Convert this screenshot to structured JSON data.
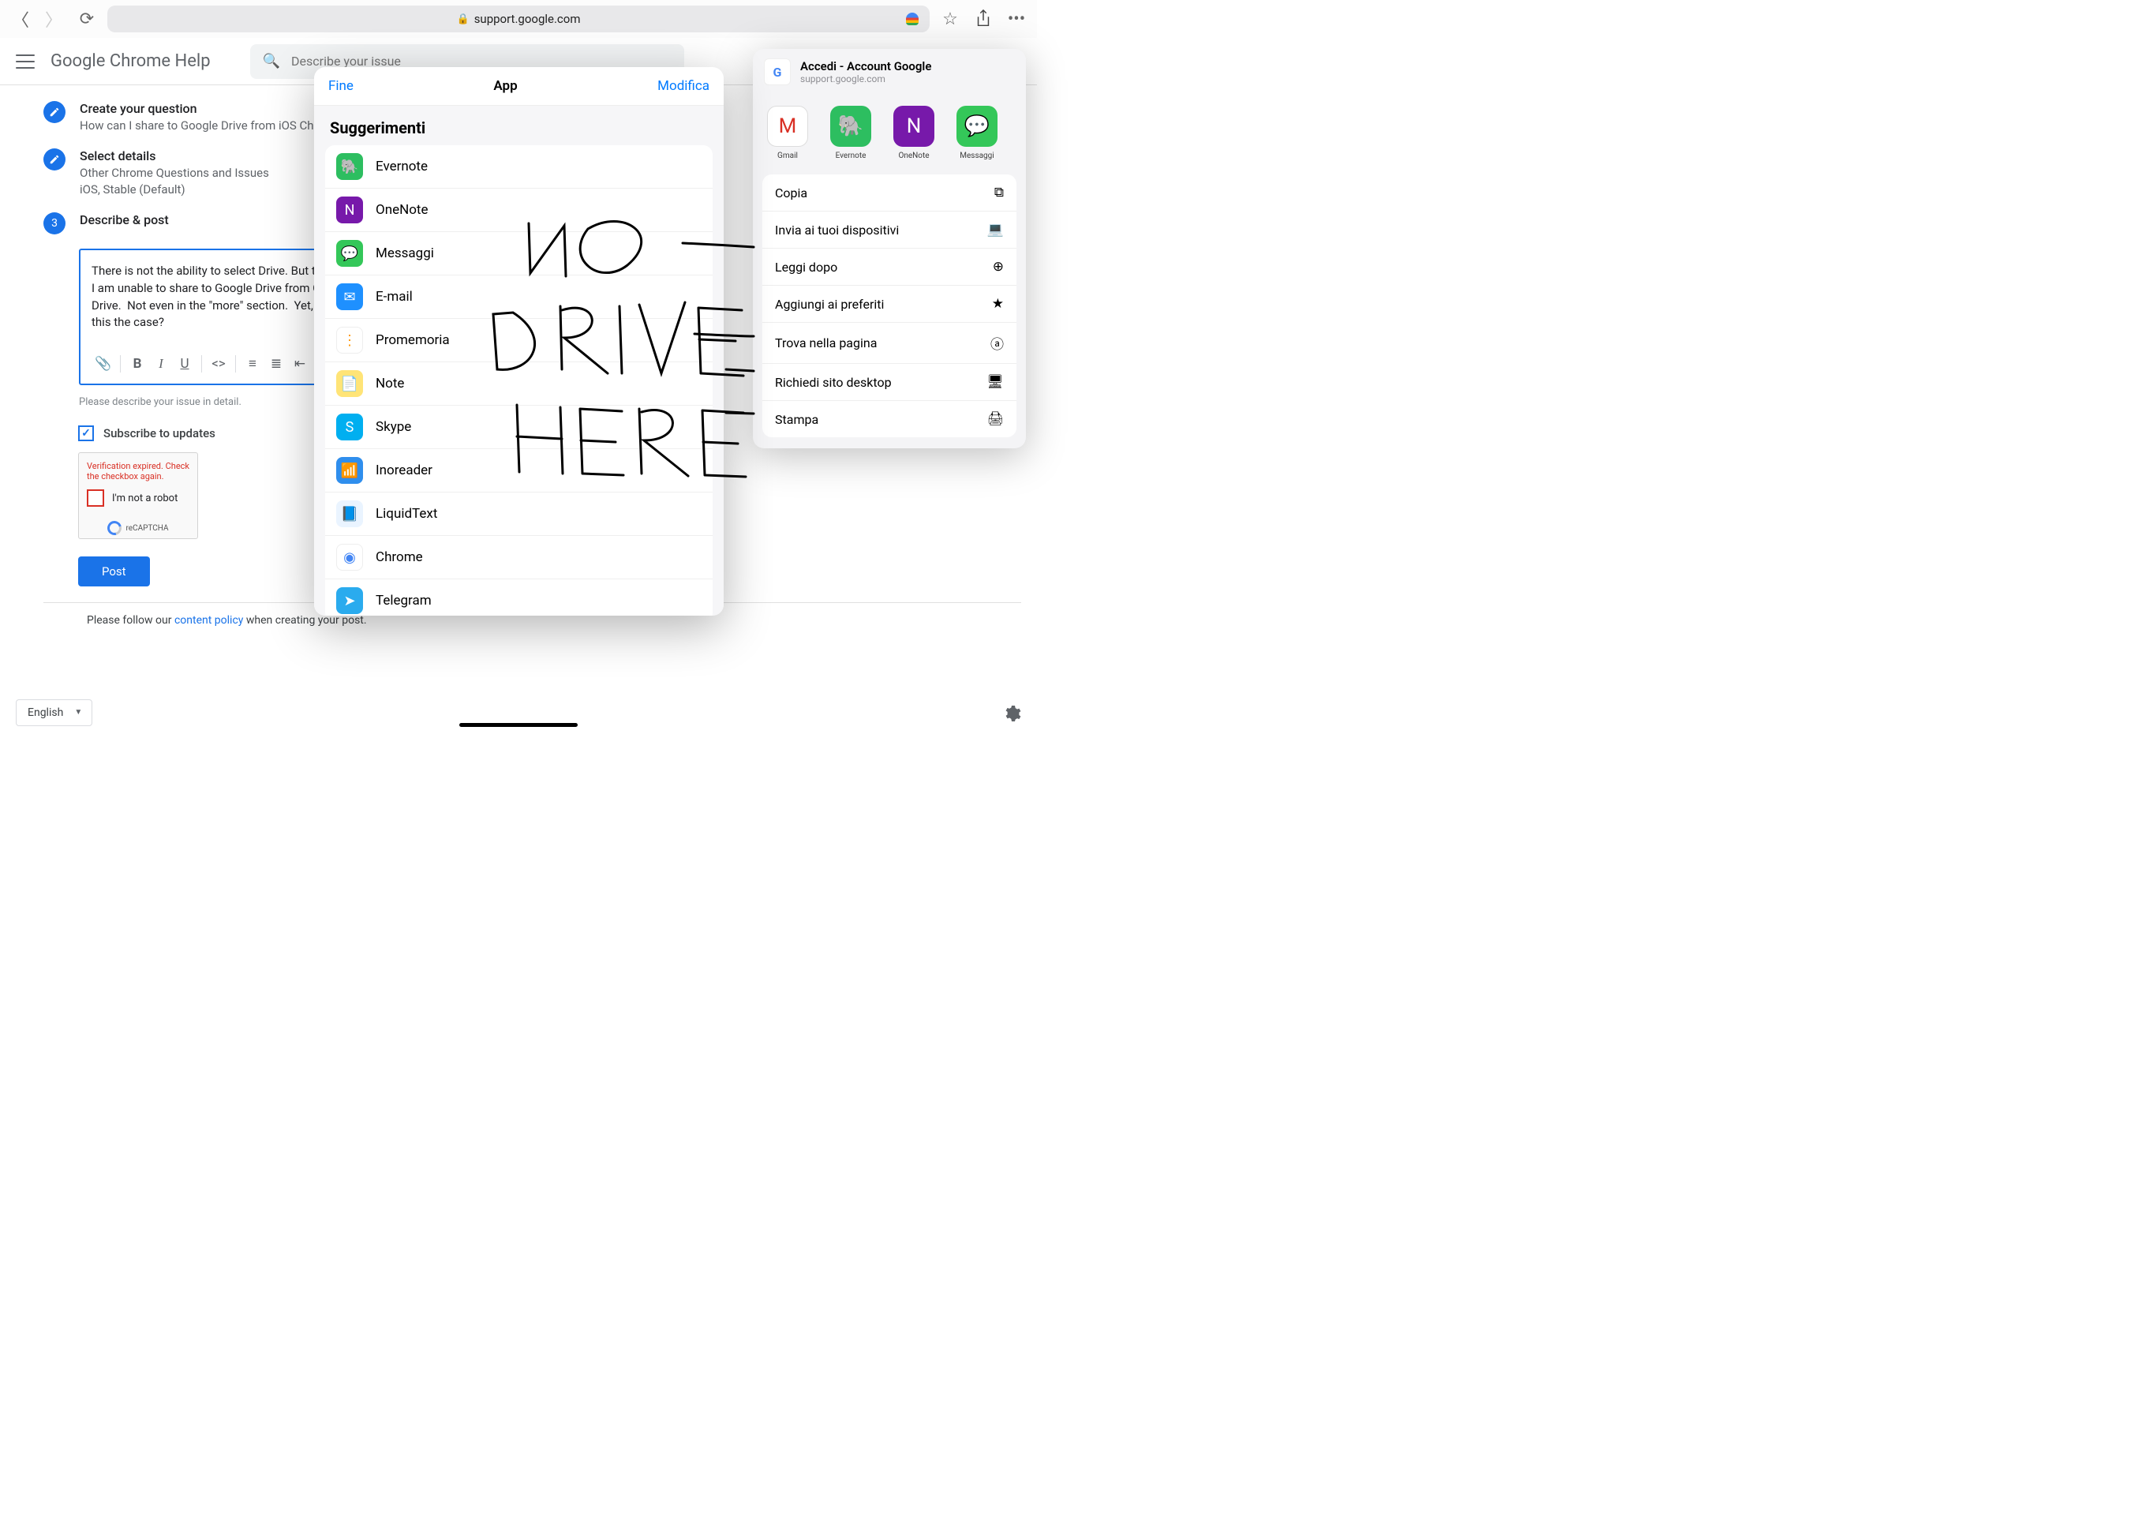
{
  "browser": {
    "url_host": "support.google.com",
    "back_enabled": true,
    "forward_enabled": false
  },
  "header": {
    "title": "Google Chrome Help",
    "search_placeholder": "Describe your issue"
  },
  "steps": {
    "s1_title": "Create your question",
    "s1_sub": "How can I share to Google Drive from iOS Chro",
    "s2_title": "Select details",
    "s2_sub1": "Other Chrome Questions and Issues",
    "s2_sub2": "iOS, Stable (Default)",
    "s3_title": "Describe & post",
    "s3_number": "3"
  },
  "editor": {
    "text": "There is not the ability to select Drive. But the\nI am unable to share to Google Drive from Ch\nDrive.  Not even in the \"more\" section.  Yet, I c\nthis the case?",
    "helper": "Please describe your issue in detail."
  },
  "subscribe": {
    "label": "Subscribe to updates",
    "checked": true
  },
  "captcha": {
    "error": "Verification expired. Check the checkbox again.",
    "label": "I'm not a robot",
    "brand": "reCAPTCHA"
  },
  "post_label": "Post",
  "policy": {
    "pre": "Please follow our ",
    "link": "content policy",
    "post": " when creating your post."
  },
  "language": "English",
  "share": {
    "title": "Accedi - Account Google",
    "sub": "support.google.com",
    "apps": [
      {
        "label": "Gmail",
        "bg": "#ffffff",
        "glyph": "M",
        "fg": "#d93025",
        "border": "#ddd"
      },
      {
        "label": "Evernote",
        "bg": "#2dbe60",
        "glyph": "🐘"
      },
      {
        "label": "OneNote",
        "bg": "#7719aa",
        "glyph": "N"
      },
      {
        "label": "Messaggi",
        "bg": "#34c759",
        "glyph": "💬"
      }
    ],
    "actions": [
      {
        "label": "Copia",
        "icon": "⧉"
      },
      {
        "label": "Invia ai tuoi dispositivi",
        "icon": "💻"
      },
      {
        "label": "Leggi dopo",
        "icon": "⊕"
      },
      {
        "label": "Aggiungi ai preferiti",
        "icon": "★"
      },
      {
        "label": "Trova nella pagina",
        "icon": "ⓐ"
      },
      {
        "label": "Richiedi sito desktop",
        "icon": "🖥"
      },
      {
        "label": "Stampa",
        "icon": "🖨"
      }
    ]
  },
  "modal": {
    "done": "Fine",
    "title": "App",
    "edit": "Modifica",
    "section": "Suggerimenti",
    "items": [
      {
        "label": "Evernote",
        "bg": "#2dbe60",
        "glyph": "🐘"
      },
      {
        "label": "OneNote",
        "bg": "#7719aa",
        "glyph": "N"
      },
      {
        "label": "Messaggi",
        "bg": "#34c759",
        "glyph": "💬"
      },
      {
        "label": "E-mail",
        "bg": "#1e90ff",
        "glyph": "✉"
      },
      {
        "label": "Promemoria",
        "bg": "#ffffff",
        "glyph": "⋮",
        "fg": "#ff9500",
        "border": "#eee"
      },
      {
        "label": "Note",
        "bg": "#ffe477",
        "glyph": "📄"
      },
      {
        "label": "Skype",
        "bg": "#00aff0",
        "glyph": "S"
      },
      {
        "label": "Inoreader",
        "bg": "#2f8eed",
        "glyph": "📶"
      },
      {
        "label": "LiquidText",
        "bg": "#eaf4ff",
        "glyph": "📘",
        "fg": "#2f8eed"
      },
      {
        "label": "Chrome",
        "bg": "#ffffff",
        "glyph": "◉",
        "fg": "#4285f4",
        "border": "#eee"
      },
      {
        "label": "Telegram",
        "bg": "#2aabee",
        "glyph": "➤"
      }
    ]
  },
  "annotation": "NO DRIVE HERE"
}
